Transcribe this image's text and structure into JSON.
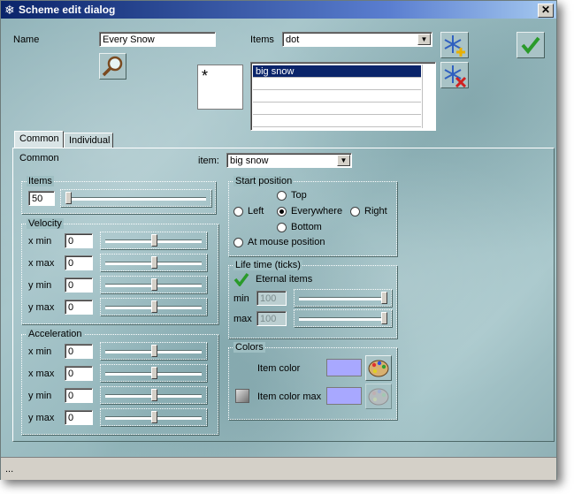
{
  "window": {
    "title": "Scheme edit dialog",
    "close_glyph": "✕"
  },
  "top": {
    "name_label": "Name",
    "name_value": "Every Snow",
    "items_label": "Items",
    "items_value": "dot",
    "preview_char": "*",
    "list_items": [
      "big snow"
    ]
  },
  "tabs": [
    {
      "label": "Common"
    },
    {
      "label": "Individual"
    }
  ],
  "common": {
    "header_label": "Common",
    "item_label": "item:",
    "item_value": "big snow",
    "items_group": {
      "title": "Items",
      "value": "50",
      "slider": 0.0
    },
    "velocity": {
      "title": "Velocity",
      "rows": [
        {
          "label": "x min",
          "value": "0",
          "slider": 0.5
        },
        {
          "label": "x max",
          "value": "0",
          "slider": 0.5
        },
        {
          "label": "y min",
          "value": "0",
          "slider": 0.5
        },
        {
          "label": "y max",
          "value": "0",
          "slider": 0.5
        }
      ]
    },
    "acceleration": {
      "title": "Acceleration",
      "rows": [
        {
          "label": "x min",
          "value": "0",
          "slider": 0.5
        },
        {
          "label": "x max",
          "value": "0",
          "slider": 0.5
        },
        {
          "label": "y min",
          "value": "0",
          "slider": 0.5
        },
        {
          "label": "y max",
          "value": "0",
          "slider": 0.5
        }
      ]
    },
    "start_position": {
      "title": "Start position",
      "top": "Top",
      "left": "Left",
      "everywhere": "Everywhere",
      "right": "Right",
      "bottom": "Bottom",
      "mouse": "At mouse position",
      "selected": "everywhere"
    },
    "life_time": {
      "title": "Life time (ticks)",
      "eternal_label": "Eternal items",
      "eternal_checked": true,
      "min_label": "min",
      "min_value": "100",
      "min_slider": 1.0,
      "max_label": "max",
      "max_value": "100",
      "max_slider": 1.0
    },
    "colors": {
      "title": "Colors",
      "item_color_label": "Item color",
      "item_color_max_label": "Item color max",
      "item_color": "#a8a8ff",
      "item_color_max": "#a8a8ff"
    }
  },
  "status": {
    "text": "..."
  },
  "icons": [
    "snowflake-icon",
    "magnifier-icon",
    "add-snowflake-icon",
    "delete-snowflake-icon",
    "check-icon",
    "palette-icon"
  ],
  "colors": {
    "title_start": "#0a246a",
    "title_end": "#a6caf0",
    "selection": "#0a246a",
    "check": "#2a9a2a"
  }
}
